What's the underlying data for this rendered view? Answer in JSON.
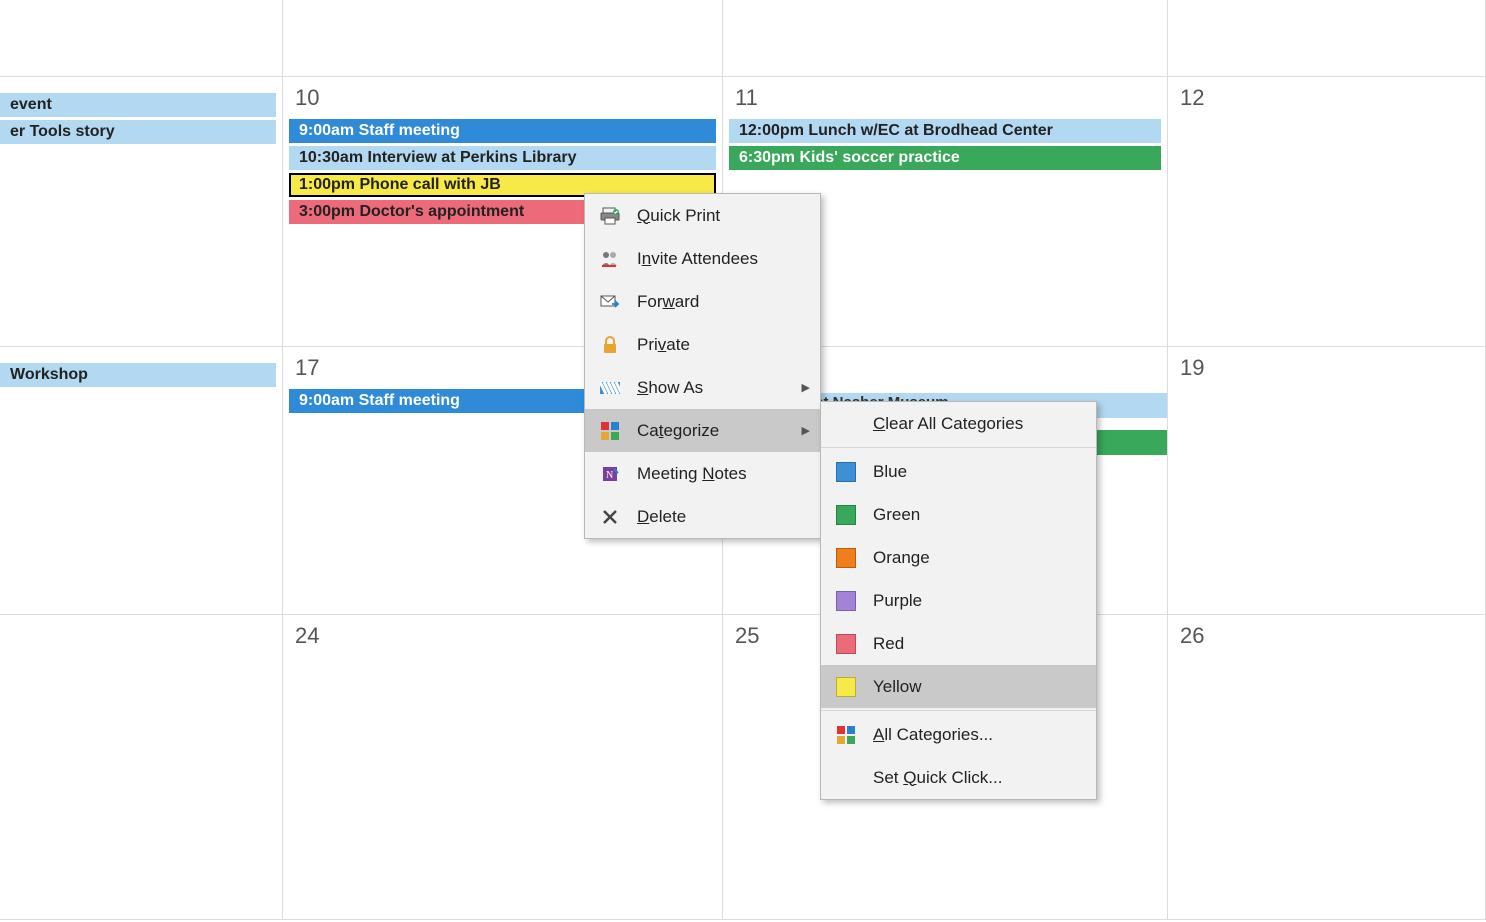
{
  "calendar": {
    "rows": [
      {
        "cells": [
          {
            "day": "",
            "events": [
              {
                "text": "event",
                "cls": "ev-lightblue"
              },
              {
                "text": "er Tools story",
                "cls": "ev-lightblue"
              }
            ]
          },
          {
            "day": "10",
            "events": [
              {
                "text": "9:00am Staff meeting",
                "cls": "ev-blue"
              },
              {
                "text": "10:30am Interview at Perkins Library",
                "cls": "ev-lightblue"
              },
              {
                "text": "1:00pm Phone call with JB",
                "cls": "ev-yellow"
              },
              {
                "text": "3:00pm Doctor's appointment",
                "cls": "ev-red"
              }
            ]
          },
          {
            "day": "11",
            "events": [
              {
                "text": "12:00pm Lunch w/EC at Brodhead Center",
                "cls": "ev-lightblue"
              },
              {
                "text": "6:30pm Kids' soccer practice",
                "cls": "ev-green"
              }
            ]
          },
          {
            "day": "12",
            "events": []
          }
        ]
      },
      {
        "cells": [
          {
            "day": "",
            "events": [
              {
                "text": "Workshop",
                "cls": "ev-lightblue"
              }
            ]
          },
          {
            "day": "17",
            "events": [
              {
                "text": "9:00am Staff meeting",
                "cls": "ev-blue"
              }
            ]
          },
          {
            "day": "",
            "events": []
          },
          {
            "day": "19",
            "events": []
          }
        ]
      },
      {
        "cells": [
          {
            "day": "",
            "events": []
          },
          {
            "day": "24",
            "events": []
          },
          {
            "day": "25",
            "events": []
          },
          {
            "day": "26",
            "events": []
          }
        ]
      }
    ],
    "partial_obscured_event": "t exhibition at Nasher Museum"
  },
  "context_menu": {
    "items": [
      {
        "icon": "printer-icon",
        "label": "Quick Print",
        "accel": "Q"
      },
      {
        "icon": "attendees-icon",
        "label": "Invite Attendees",
        "accel": "n"
      },
      {
        "icon": "forward-icon",
        "label": "Forward",
        "accel": "w"
      },
      {
        "icon": "lock-icon",
        "label": "Private",
        "accel": "v"
      },
      {
        "icon": "showas-icon",
        "label": "Show As",
        "accel": "S",
        "submenu": true
      },
      {
        "icon": "categorize-icon",
        "label": "Categorize",
        "accel": "t",
        "submenu": true,
        "highlight": true
      },
      {
        "icon": "onenote-icon",
        "label": "Meeting Notes",
        "accel": "N"
      },
      {
        "icon": "delete-icon",
        "label": "Delete",
        "accel": "D"
      }
    ]
  },
  "categorize_submenu": {
    "clear_label": "Clear All Categories",
    "colors": [
      {
        "name": "Blue",
        "cls": "sw-blue"
      },
      {
        "name": "Green",
        "cls": "sw-green"
      },
      {
        "name": "Orange",
        "cls": "sw-orange"
      },
      {
        "name": "Purple",
        "cls": "sw-purple"
      },
      {
        "name": "Red",
        "cls": "sw-red"
      },
      {
        "name": "Yellow",
        "cls": "sw-yellow",
        "highlight": true
      }
    ],
    "all_label": "All Categories...",
    "quick_label": "Set Quick Click..."
  }
}
